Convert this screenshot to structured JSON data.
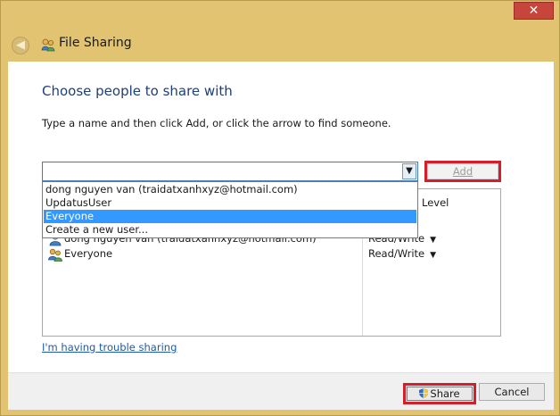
{
  "window": {
    "title": "File Sharing",
    "close_glyph": "✕",
    "back_glyph": "◀"
  },
  "content": {
    "heading": "Choose people to share with",
    "instruction": "Type a name and then click Add, or click the arrow to find someone.",
    "combo_value": "",
    "combo_arrow": "▼",
    "add_label": "Add"
  },
  "table": {
    "perm_header": "Level",
    "rows": [
      {
        "name": "dong nguyen van (traidatxanhxyz@hotmail.com)",
        "permission": "Read/Write",
        "icon": "user-icon"
      },
      {
        "name": "Everyone",
        "permission": "Read/Write",
        "icon": "group-icon"
      }
    ]
  },
  "dropdown": {
    "items": [
      {
        "label": "dong nguyen van (traidatxanhxyz@hotmail.com)",
        "selected": false
      },
      {
        "label": "UpdatusUser",
        "selected": false
      },
      {
        "label": "Everyone",
        "selected": true
      },
      {
        "label": "Create a new user...",
        "selected": false
      }
    ]
  },
  "links": {
    "trouble": "I'm having trouble sharing"
  },
  "footer": {
    "share_label": "Share",
    "cancel_label": "Cancel"
  },
  "colors": {
    "frame": "#e1c372",
    "heading": "#1e3f78",
    "highlight": "#d31f2b",
    "selection": "#3399ff",
    "link": "#1e5aa8"
  }
}
